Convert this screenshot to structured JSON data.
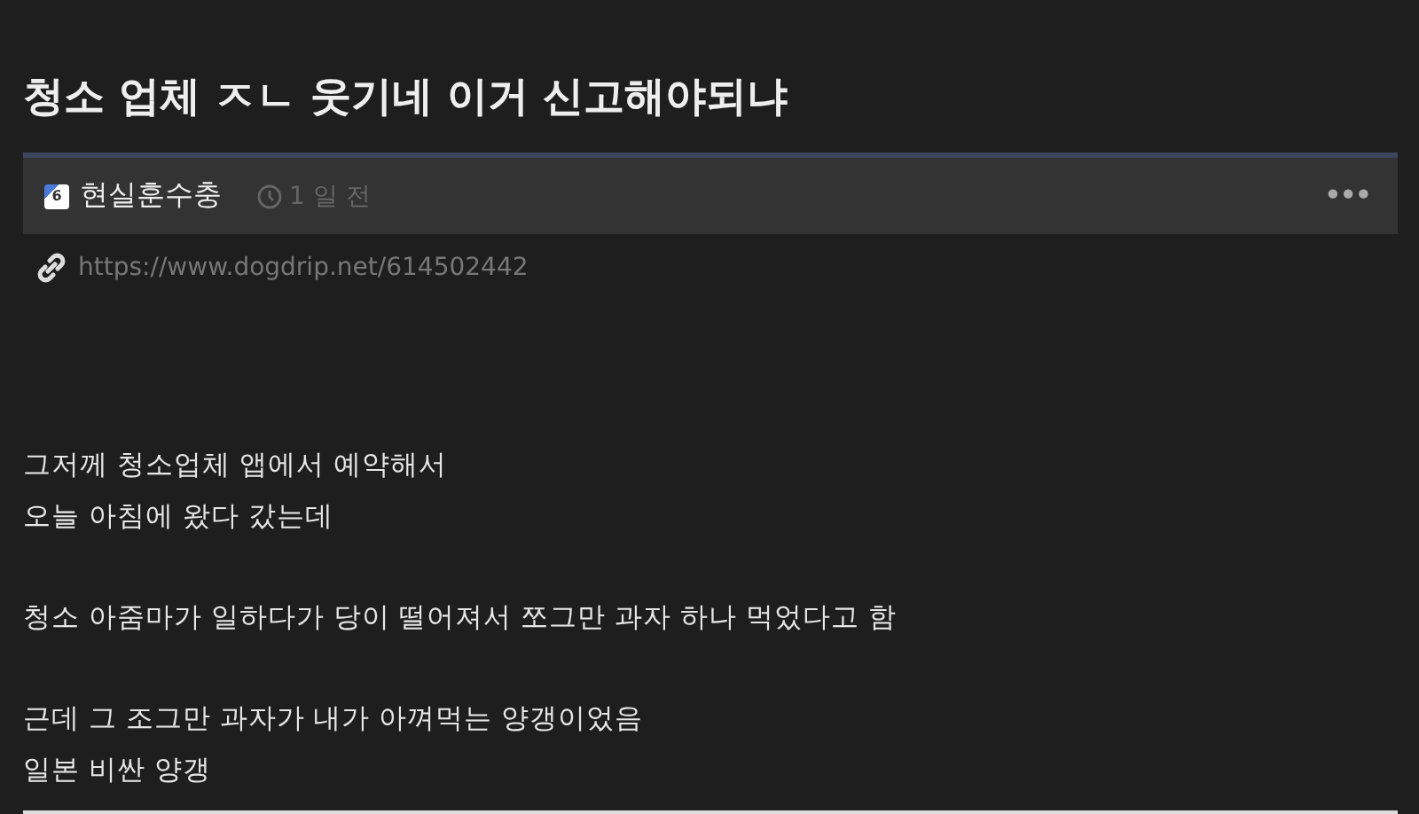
{
  "post": {
    "title": "청소 업체 ㅈㄴ 웃기네 이거 신고해야되냐",
    "author": {
      "level": "6",
      "name": "현실훈수충"
    },
    "time": "1 일 전",
    "more": "•••",
    "link": "https://www.dogdrip.net/614502442",
    "paragraphs": [
      [
        "그저께 청소업체 앱에서 예약해서",
        "오늘 아침에 왔다 갔는데"
      ],
      [
        "청소 아줌마가 일하다가 당이 떨어져서 쪼그만 과자 하나 먹었다고 함"
      ],
      [
        "근데 그 조그만 과자가 내가 아껴먹는 양갱이었음",
        "일본 비싼 양갱"
      ]
    ]
  }
}
